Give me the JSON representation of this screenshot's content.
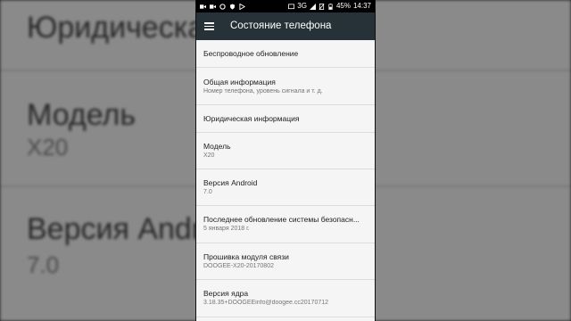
{
  "background": {
    "rows": [
      {
        "title": "Юридическая",
        "subtitle": ""
      },
      {
        "title": "Модель",
        "subtitle": "X20"
      },
      {
        "title": "Версия Android",
        "subtitle": "7.0"
      }
    ]
  },
  "status_bar": {
    "network": "3G",
    "battery": "45%",
    "time": "14:37",
    "left_icons": [
      "video-icon",
      "video-icon",
      "circle-icon",
      "shield-icon",
      "play-store-icon"
    ],
    "right_icons": [
      "cast-icon",
      "signal-icon",
      "no-sim-icon",
      "battery-icon"
    ]
  },
  "toolbar": {
    "menu_icon": "hamburger-menu-icon",
    "title": "Состояние телефона"
  },
  "items": [
    {
      "title": "Беспроводное обновление",
      "subtitle": ""
    },
    {
      "title": "Общая информация",
      "subtitle": "Номер телефона, уровень сигнала и т. д."
    },
    {
      "title": "Юридическая информация",
      "subtitle": ""
    },
    {
      "title": "Модель",
      "subtitle": "X20"
    },
    {
      "title": "Версия Android",
      "subtitle": "7.0"
    },
    {
      "title": "Последнее обновление системы безопасн...",
      "subtitle": "5 января 2018 г."
    },
    {
      "title": "Прошивка модуля связи",
      "subtitle": "DOOGEE-X20-20170802"
    },
    {
      "title": "Версия ядра",
      "subtitle": "3.18.35+DOOGEEinfo@doogee.cc20170712"
    }
  ],
  "colors": {
    "toolbar": "#263238",
    "list_background": "#f5f5f5",
    "divider": "#dcdcdc",
    "title_text": "#212121",
    "subtitle_text": "#757575"
  }
}
